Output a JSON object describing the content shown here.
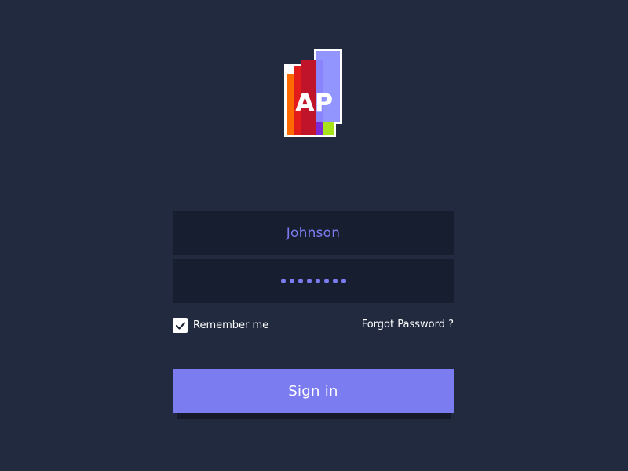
{
  "logo": {
    "text": "AP",
    "colors": [
      "#ff6a00",
      "#e01a1a",
      "#7c2bd6",
      "#8a8cff",
      "#a8e21a"
    ]
  },
  "form": {
    "username_value": "Johnson",
    "password_mask": "••••••••",
    "password_length": 8,
    "remember_label": "Remember me",
    "remember_checked": true,
    "forgot_label": "Forgot Password ?",
    "signin_label": "Sign in"
  },
  "colors": {
    "background": "#212a3e",
    "field_bg": "#171e30",
    "accent": "#7b7cf0",
    "text": "#ffffff"
  },
  "icons": {
    "check": "check-icon",
    "logo": "app-logo-icon"
  }
}
